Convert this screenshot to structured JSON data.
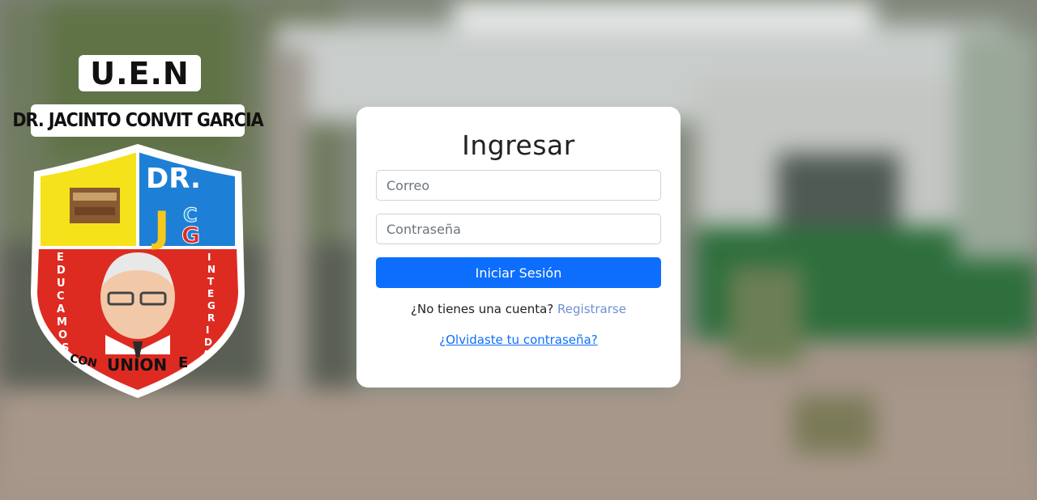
{
  "logo": {
    "acronym": "U.E.N",
    "school_name": "DR. JACINTO CONVIT GARCIA",
    "shield_text": "DR. JCG",
    "motto_left": "EDUCAMOS",
    "motto_right": "INTEGRIDA",
    "motto_bottom": "CON UNION E"
  },
  "login": {
    "title": "Ingresar",
    "email_placeholder": "Correo",
    "password_placeholder": "Contraseña",
    "submit_label": "Iniciar Sesión",
    "register_prompt": "¿No tienes una cuenta?",
    "register_link": "Registrarse",
    "forgot_link": "¿Olvidaste tu contraseña?"
  },
  "colors": {
    "primary": "#0d6efd",
    "link": "#6c8fd6",
    "card": "#ffffff"
  }
}
